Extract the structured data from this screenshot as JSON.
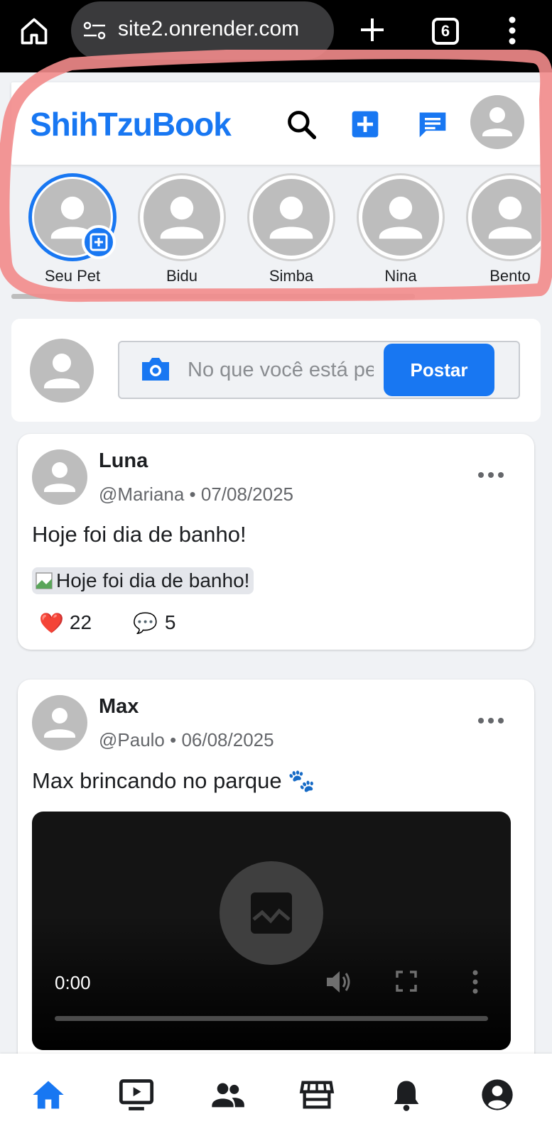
{
  "browser": {
    "url": "site2.onrender.com",
    "tab_count": "6"
  },
  "header": {
    "brand": "ShihTzuBook"
  },
  "stories": [
    {
      "name": "Seu Pet",
      "active": true
    },
    {
      "name": "Bidu"
    },
    {
      "name": "Simba"
    },
    {
      "name": "Nina"
    },
    {
      "name": "Bento"
    }
  ],
  "composer": {
    "placeholder": "No que você está pensando?",
    "post_label": "Postar"
  },
  "posts": [
    {
      "name": "Luna",
      "meta": "@Mariana • 07/08/2025",
      "text": "Hoje foi dia de banho!",
      "image_alt": "Hoje foi dia de banho!",
      "likes": "22",
      "comments": "5",
      "like_emoji": "❤️",
      "comment_emoji": "💬"
    },
    {
      "name": "Max",
      "meta": "@Paulo • 06/08/2025",
      "text": "Max brincando no parque 🐾",
      "video_time": "0:00"
    }
  ],
  "colors": {
    "brand": "#1877f2",
    "annotation": "#f28b8b"
  },
  "icons": [
    "home-icon",
    "video-icon",
    "friends-icon",
    "marketplace-icon",
    "bell-icon",
    "account-icon"
  ]
}
